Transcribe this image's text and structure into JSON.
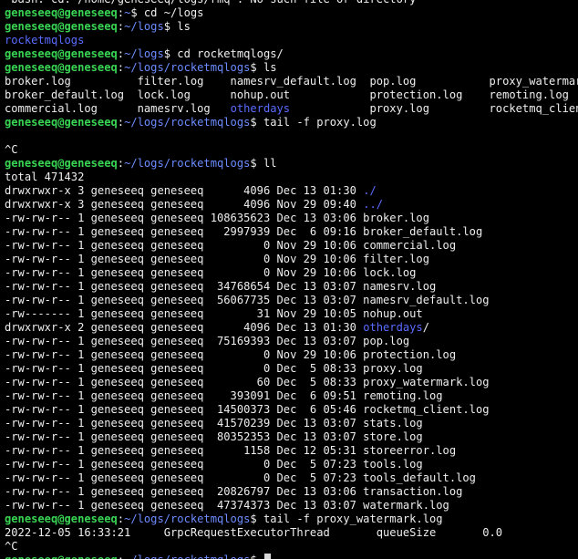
{
  "user_host": "geneseeq@geneseeq",
  "colors": {
    "background": "#000000",
    "text": "#eeeeee",
    "user_host": "#39d353",
    "path": "#6c8cff",
    "directory": "#5a6cff"
  },
  "lines": [
    {
      "type": "out",
      "text": "-bash: cd: /home/geneseeq/logs/rmq~: No such file or directory"
    },
    {
      "type": "prompt",
      "path": "~",
      "cmd": " cd ~/logs"
    },
    {
      "type": "prompt",
      "path": "~/logs",
      "cmd": " ls"
    },
    {
      "type": "dir",
      "text": "rocketmqlogs"
    },
    {
      "type": "prompt",
      "path": "~/logs",
      "cmd": " cd rocketmqlogs/"
    },
    {
      "type": "prompt",
      "path": "~/logs/rocketmqlogs",
      "cmd": " ls"
    },
    {
      "type": "out",
      "text": "broker.log          filter.log    namesrv_default.log  pop.log           proxy_watermark.log"
    },
    {
      "type": "out",
      "text": "broker_default.log  lock.log      nohup.out            protection.log    remoting.log"
    },
    {
      "type": "mixed",
      "before": "commercial.log      namesrv.log   ",
      "dir": "otherdays",
      "after": "            proxy.log         rocketmq_client.log"
    },
    {
      "type": "prompt",
      "path": "~/logs/rocketmqlogs",
      "cmd": " tail -f proxy.log"
    },
    {
      "type": "out",
      "text": ""
    },
    {
      "type": "out",
      "text": "^C"
    },
    {
      "type": "prompt",
      "path": "~/logs/rocketmqlogs",
      "cmd": " ll"
    },
    {
      "type": "out",
      "text": "total 471432"
    },
    {
      "type": "mixed",
      "before": "drwxrwxr-x 3 geneseeq geneseeq      4096 Dec 13 01:30 ",
      "dir": "./",
      "after": ""
    },
    {
      "type": "mixed",
      "before": "drwxrwxr-x 3 geneseeq geneseeq      4096 Nov 29 09:40 ",
      "dir": "../",
      "after": ""
    },
    {
      "type": "out",
      "text": "-rw-rw-r-- 1 geneseeq geneseeq 108635623 Dec 13 03:06 broker.log"
    },
    {
      "type": "out",
      "text": "-rw-rw-r-- 1 geneseeq geneseeq   2997939 Dec  6 09:16 broker_default.log"
    },
    {
      "type": "out",
      "text": "-rw-rw-r-- 1 geneseeq geneseeq         0 Nov 29 10:06 commercial.log"
    },
    {
      "type": "out",
      "text": "-rw-rw-r-- 1 geneseeq geneseeq         0 Nov 29 10:06 filter.log"
    },
    {
      "type": "out",
      "text": "-rw-rw-r-- 1 geneseeq geneseeq         0 Nov 29 10:06 lock.log"
    },
    {
      "type": "out",
      "text": "-rw-rw-r-- 1 geneseeq geneseeq  34768654 Dec 13 03:07 namesrv.log"
    },
    {
      "type": "out",
      "text": "-rw-rw-r-- 1 geneseeq geneseeq  56067735 Dec 13 03:07 namesrv_default.log"
    },
    {
      "type": "out",
      "text": "-rw------- 1 geneseeq geneseeq        31 Nov 29 10:05 nohup.out"
    },
    {
      "type": "mixed",
      "before": "drwxrwxr-x 2 geneseeq geneseeq      4096 Dec 13 01:30 ",
      "dir": "otherdays",
      "after": "/"
    },
    {
      "type": "out",
      "text": "-rw-rw-r-- 1 geneseeq geneseeq  75169393 Dec 13 03:07 pop.log"
    },
    {
      "type": "out",
      "text": "-rw-rw-r-- 1 geneseeq geneseeq         0 Nov 29 10:06 protection.log"
    },
    {
      "type": "out",
      "text": "-rw-rw-r-- 1 geneseeq geneseeq         0 Dec  5 08:33 proxy.log"
    },
    {
      "type": "out",
      "text": "-rw-rw-r-- 1 geneseeq geneseeq        60 Dec  5 08:33 proxy_watermark.log"
    },
    {
      "type": "out",
      "text": "-rw-rw-r-- 1 geneseeq geneseeq    393091 Dec  6 09:51 remoting.log"
    },
    {
      "type": "out",
      "text": "-rw-rw-r-- 1 geneseeq geneseeq  14500373 Dec  6 05:46 rocketmq_client.log"
    },
    {
      "type": "out",
      "text": "-rw-rw-r-- 1 geneseeq geneseeq  41570239 Dec 13 03:07 stats.log"
    },
    {
      "type": "out",
      "text": "-rw-rw-r-- 1 geneseeq geneseeq  80352353 Dec 13 03:07 store.log"
    },
    {
      "type": "out",
      "text": "-rw-rw-r-- 1 geneseeq geneseeq      1158 Dec 12 05:31 storeerror.log"
    },
    {
      "type": "out",
      "text": "-rw-rw-r-- 1 geneseeq geneseeq         0 Dec  5 07:23 tools.log"
    },
    {
      "type": "out",
      "text": "-rw-rw-r-- 1 geneseeq geneseeq         0 Dec  5 07:23 tools_default.log"
    },
    {
      "type": "out",
      "text": "-rw-rw-r-- 1 geneseeq geneseeq  20826797 Dec 13 03:06 transaction.log"
    },
    {
      "type": "out",
      "text": "-rw-rw-r-- 1 geneseeq geneseeq  47374373 Dec 13 03:07 watermark.log"
    },
    {
      "type": "prompt",
      "path": "~/logs/rocketmqlogs",
      "cmd": " tail -f proxy_watermark.log"
    },
    {
      "type": "out",
      "text": "2022-12-05 16:33:21     GrpcRequestExecutorThread       queueSize       0.0"
    },
    {
      "type": "out",
      "text": "^C"
    },
    {
      "type": "prompt",
      "path": "~/logs/rocketmqlogs",
      "cmd": " ",
      "cursor": true
    }
  ]
}
